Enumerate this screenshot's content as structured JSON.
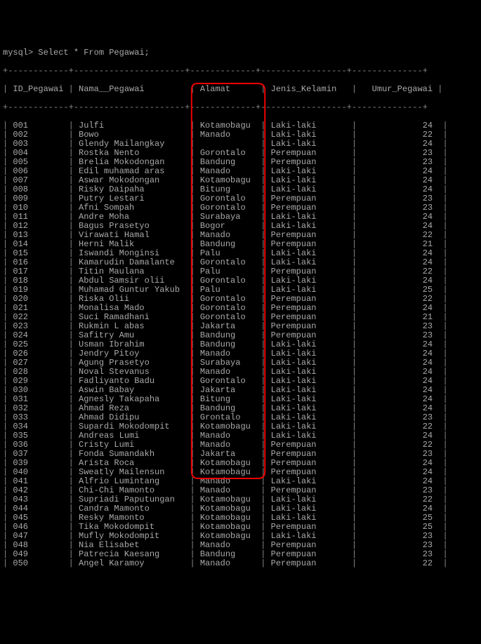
{
  "prompt": "mysql> Select * From Pegawai;",
  "columns": [
    "ID_Pegawai",
    "Nama__Pegawai",
    "Alamat",
    "Jenis_Kelamin",
    "Umur_Pegawai"
  ],
  "rows": [
    {
      "id": "001",
      "nama": "Julfi",
      "alamat": "Kotamobagu",
      "jk": "Laki-laki",
      "umur": 24
    },
    {
      "id": "002",
      "nama": "Bowo",
      "alamat": "Manado",
      "jk": "Laki-laki",
      "umur": 22
    },
    {
      "id": "003",
      "nama": "Glendy Mailangkay",
      "alamat": "",
      "jk": "Laki-laki",
      "umur": 24
    },
    {
      "id": "004",
      "nama": "Rostka Nento",
      "alamat": "Gorontalo",
      "jk": "Perempuan",
      "umur": 23
    },
    {
      "id": "005",
      "nama": "Brelia Mokodongan",
      "alamat": "Bandung",
      "jk": "Perempuan",
      "umur": 23
    },
    {
      "id": "006",
      "nama": "Edil muhamad aras",
      "alamat": "Manado",
      "jk": "Laki-laki",
      "umur": 24
    },
    {
      "id": "007",
      "nama": "Aswar Mokodongan",
      "alamat": "Kotamobagu",
      "jk": "Laki-laki",
      "umur": 24
    },
    {
      "id": "008",
      "nama": "Risky Daipaha",
      "alamat": "Bitung",
      "jk": "Laki-laki",
      "umur": 24
    },
    {
      "id": "009",
      "nama": "Putry Lestari",
      "alamat": "Gorontalo",
      "jk": "Perempuan",
      "umur": 23
    },
    {
      "id": "010",
      "nama": "Afni Sompah",
      "alamat": "Gorontalo",
      "jk": "Perempuan",
      "umur": 23
    },
    {
      "id": "011",
      "nama": "Andre Moha",
      "alamat": "Surabaya",
      "jk": "Laki-laki",
      "umur": 24
    },
    {
      "id": "012",
      "nama": "Bagus Prasetyo",
      "alamat": "Bogor",
      "jk": "Laki-laki",
      "umur": 24
    },
    {
      "id": "013",
      "nama": "Virawati Hamal",
      "alamat": "Manado",
      "jk": "Perempuan",
      "umur": 22
    },
    {
      "id": "014",
      "nama": "Herni Malik",
      "alamat": "Bandung",
      "jk": "Perempuan",
      "umur": 21
    },
    {
      "id": "015",
      "nama": "Iswandi Monginsi",
      "alamat": "Palu",
      "jk": "Laki-laki",
      "umur": 24
    },
    {
      "id": "016",
      "nama": "Kamarudin Damalante",
      "alamat": "Gorontalo",
      "jk": "Laki-laki",
      "umur": 24
    },
    {
      "id": "017",
      "nama": "Titin Maulana",
      "alamat": "Palu",
      "jk": "Perempuan",
      "umur": 22
    },
    {
      "id": "018",
      "nama": "Abdul Samsir olii",
      "alamat": "Gorontalo",
      "jk": "Laki-laki",
      "umur": 24
    },
    {
      "id": "019",
      "nama": "Muhamad Guntur Yakub",
      "alamat": "Palu",
      "jk": "Laki-laki",
      "umur": 25
    },
    {
      "id": "020",
      "nama": "Riska Olii",
      "alamat": "Gorontalo",
      "jk": "Perempuan",
      "umur": 22
    },
    {
      "id": "021",
      "nama": "Monalisa Mado",
      "alamat": "Gorontalo",
      "jk": "Perempuan",
      "umur": 24
    },
    {
      "id": "022",
      "nama": "Suci Ramadhani",
      "alamat": "Gorontalo",
      "jk": "Perempuan",
      "umur": 21
    },
    {
      "id": "023",
      "nama": "Rukmin L abas",
      "alamat": "Jakarta",
      "jk": "Perempuan",
      "umur": 23
    },
    {
      "id": "024",
      "nama": "Safitry Amu",
      "alamat": "Bandung",
      "jk": "Perempuan",
      "umur": 23
    },
    {
      "id": "025",
      "nama": "Usman Ibrahim",
      "alamat": "Bandung",
      "jk": "Laki-laki",
      "umur": 24
    },
    {
      "id": "026",
      "nama": "Jendry Pitoy",
      "alamat": "Manado",
      "jk": "Laki-laki",
      "umur": 24
    },
    {
      "id": "027",
      "nama": "Agung Prasetyo",
      "alamat": "Surabaya",
      "jk": "Laki-laki",
      "umur": 24
    },
    {
      "id": "028",
      "nama": "Noval Stevanus",
      "alamat": "Manado",
      "jk": "Laki-laki",
      "umur": 24
    },
    {
      "id": "029",
      "nama": "Fadliyanto Badu",
      "alamat": "Gorontalo",
      "jk": "Laki-laki",
      "umur": 24
    },
    {
      "id": "030",
      "nama": "Aswin Babay",
      "alamat": "Jakarta",
      "jk": "Laki-laki",
      "umur": 24
    },
    {
      "id": "031",
      "nama": "Agnesly Takapaha",
      "alamat": "Bitung",
      "jk": "Laki-laki",
      "umur": 24
    },
    {
      "id": "032",
      "nama": "Ahmad Reza",
      "alamat": "Bandung",
      "jk": "Laki-laki",
      "umur": 24
    },
    {
      "id": "033",
      "nama": "Ahmad Didipu",
      "alamat": "Grontalo",
      "jk": "Laki-laki",
      "umur": 23
    },
    {
      "id": "034",
      "nama": "Supardi Mokodompit",
      "alamat": "Kotamobagu",
      "jk": "Laki-laki",
      "umur": 22
    },
    {
      "id": "035",
      "nama": "Andreas Lumi",
      "alamat": "Manado",
      "jk": "Laki-laki",
      "umur": 24
    },
    {
      "id": "036",
      "nama": "Cristy Lumi",
      "alamat": "Manado",
      "jk": "Perempuan",
      "umur": 22
    },
    {
      "id": "037",
      "nama": "Fonda Sumandakh",
      "alamat": "Jakarta",
      "jk": "Perempuan",
      "umur": 23
    },
    {
      "id": "039",
      "nama": "Arista Roca",
      "alamat": "Kotamobagu",
      "jk": "Perempuan",
      "umur": 24
    },
    {
      "id": "040",
      "nama": "Sweatly Mailensun",
      "alamat": "Kotamobagu",
      "jk": "Perempuan",
      "umur": 24
    },
    {
      "id": "041",
      "nama": "Alfrio Lumintang",
      "alamat": "Manado",
      "jk": "Laki-laki",
      "umur": 24
    },
    {
      "id": "042",
      "nama": "Chi-Chi Mamonto",
      "alamat": "Manado",
      "jk": "Perempuan",
      "umur": 23
    },
    {
      "id": "043",
      "nama": "Supriadi Paputungan",
      "alamat": "Kotamobagu",
      "jk": "Laki-laki",
      "umur": 22
    },
    {
      "id": "044",
      "nama": "Candra Mamonto",
      "alamat": "Kotamobagu",
      "jk": "Laki-laki",
      "umur": 24
    },
    {
      "id": "045",
      "nama": "Resky Mamonto",
      "alamat": "Kotamobagu",
      "jk": "Laki-laki",
      "umur": 25
    },
    {
      "id": "046",
      "nama": "Tika Mokodompit",
      "alamat": "Kotamobagu",
      "jk": "Perempuan",
      "umur": 25
    },
    {
      "id": "047",
      "nama": "Mufly Mokodompit",
      "alamat": "Kotamobagu",
      "jk": "Laki-laki",
      "umur": 23
    },
    {
      "id": "048",
      "nama": "Nia Elisabet",
      "alamat": "Manado",
      "jk": "Perempuan",
      "umur": 23
    },
    {
      "id": "049",
      "nama": "Patrecia Kaesang",
      "alamat": "Bandung",
      "jk": "Perempuan",
      "umur": 23
    },
    {
      "id": "050",
      "nama": "Angel Karamoy",
      "alamat": "Manado",
      "jk": "Perempuan",
      "umur": 22
    }
  ],
  "annotation": {
    "top_row_index": 0,
    "bottom_row_index": 38
  }
}
